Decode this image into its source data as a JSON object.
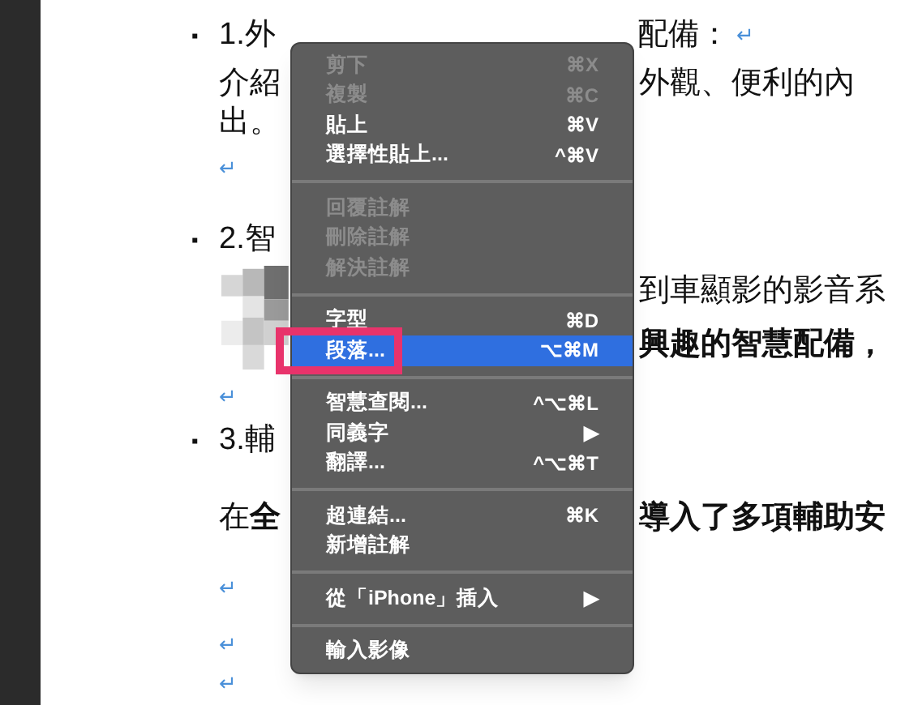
{
  "document": {
    "lines": [
      {
        "kind": "heading",
        "bullet": "▪",
        "left": "1.外",
        "right": "配備：",
        "mark": "↵"
      },
      {
        "kind": "text",
        "left": "介紹",
        "right": "外觀、便利的內"
      },
      {
        "kind": "text",
        "left": "出。"
      },
      {
        "kind": "return",
        "mark": "↵"
      },
      {
        "kind": "heading",
        "bullet": "▪",
        "left": "2.智"
      },
      {
        "kind": "picture_block",
        "rows": [
          "到車顯影的影音系",
          "**興趣的智慧配備，**"
        ]
      },
      {
        "kind": "return",
        "mark": "↵"
      },
      {
        "kind": "heading",
        "bullet": "▪",
        "left": "3.輔"
      },
      {
        "kind": "text",
        "left": "在**全**",
        "right": "**導入了多項輔助安**"
      },
      {
        "kind": "return",
        "mark": "↵"
      },
      {
        "kind": "return",
        "mark": "↵"
      },
      {
        "kind": "return",
        "mark": "↵"
      }
    ]
  },
  "context_menu": {
    "sections": [
      [
        {
          "label": "剪下",
          "shortcut": "⌘X",
          "disabled": true,
          "selected": false
        },
        {
          "label": "複製",
          "shortcut": "⌘C",
          "disabled": true,
          "selected": false
        },
        {
          "label": "貼上",
          "shortcut": "⌘V",
          "disabled": false,
          "selected": false
        },
        {
          "label": "選擇性貼上...",
          "shortcut": "^⌘V",
          "disabled": false,
          "selected": false
        }
      ],
      [
        {
          "label": "回覆註解",
          "disabled": true,
          "selected": false
        },
        {
          "label": "刪除註解",
          "disabled": true,
          "selected": false
        },
        {
          "label": "解決註解",
          "disabled": true,
          "selected": false
        }
      ],
      [
        {
          "label": "字型",
          "shortcut": "⌘D",
          "disabled": false,
          "selected": false
        },
        {
          "label": "段落...",
          "shortcut": "⌥⌘M",
          "disabled": false,
          "selected": true,
          "highlighted": true
        }
      ],
      [
        {
          "label": "智慧查閱...",
          "shortcut": "^⌥⌘L",
          "disabled": false,
          "selected": false
        },
        {
          "label": "同義字",
          "shortcut": "▶",
          "disabled": false,
          "selected": false
        },
        {
          "label": "翻譯...",
          "shortcut": "^⌥⌘T",
          "disabled": false,
          "selected": false
        }
      ],
      [
        {
          "label": "超連結...",
          "shortcut": "⌘K",
          "disabled": false,
          "selected": false
        },
        {
          "label": "新增註解",
          "disabled": false,
          "selected": false
        }
      ],
      [
        {
          "label": "從「iPhone」插入",
          "shortcut": "▶",
          "disabled": false,
          "selected": false
        }
      ],
      [
        {
          "label": "輸入影像",
          "disabled": false,
          "selected": false
        }
      ]
    ]
  }
}
